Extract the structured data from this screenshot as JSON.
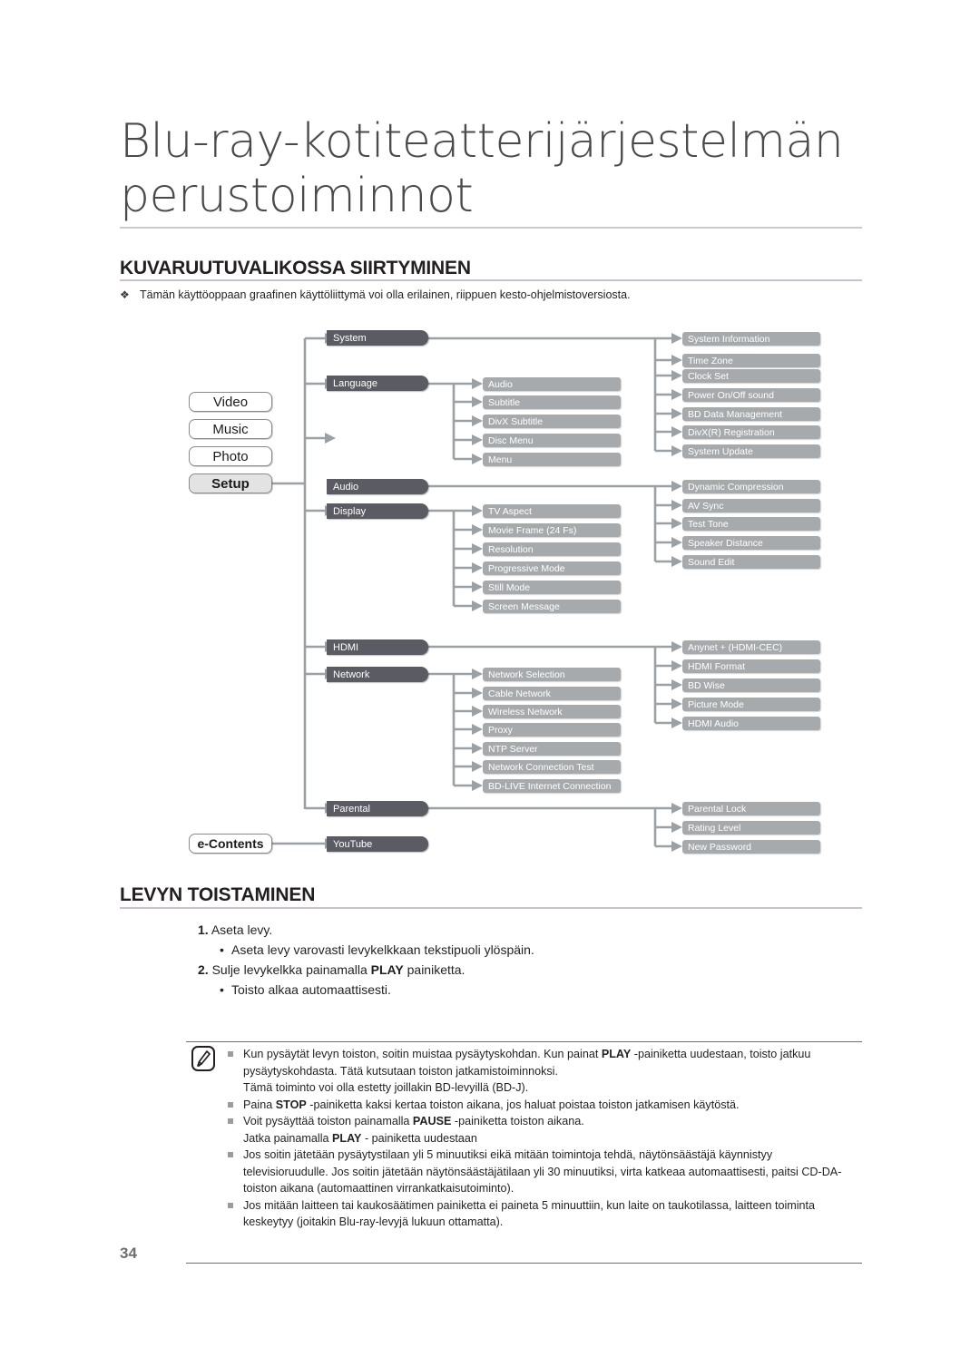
{
  "header": {
    "chapter_title": "Blu-ray-kotiteatterijärjestelmän\nperustoiminnot"
  },
  "section1": {
    "heading": "KUVARUUTUVALIKOSSA SIIRTYMINEN",
    "bullet_glyph": "❖",
    "note": "Tämän käyttöoppaan graafinen käyttöliittymä voi olla erilainen, riippuen kesto-ohjelmistoversiosta."
  },
  "diagram": {
    "level1": [
      {
        "label": "Video",
        "selected": false
      },
      {
        "label": "Music",
        "selected": false
      },
      {
        "label": "Photo",
        "selected": false
      },
      {
        "label": "Setup",
        "selected": true
      }
    ],
    "econtents": {
      "label": "e-Contents"
    },
    "level2": [
      {
        "label": "System"
      },
      {
        "label": "Language"
      },
      {
        "label": "Audio"
      },
      {
        "label": "Display"
      },
      {
        "label": "HDMI"
      },
      {
        "label": "Network"
      },
      {
        "label": "Parental"
      },
      {
        "label": "YouTube"
      }
    ],
    "system_children": [
      "System Information",
      "Time Zone",
      "Clock Set",
      "Power On/Off sound",
      "BD Data Management",
      "DivX(R) Registration",
      "System Update"
    ],
    "language_children": [
      "Audio",
      "Subtitle",
      "DivX Subtitle",
      "Disc Menu",
      "Menu"
    ],
    "audio_children": [
      "Dynamic Compression",
      "AV Sync",
      "Test Tone",
      "Speaker Distance",
      "Sound Edit"
    ],
    "display_children": [
      "TV Aspect",
      "Movie Frame (24 Fs)",
      "Resolution",
      "Progressive Mode",
      "Still Mode",
      "Screen Message"
    ],
    "hdmi_children": [
      "Anynet + (HDMI-CEC)",
      "HDMI Format",
      "BD Wise",
      "Picture Mode",
      "HDMI Audio"
    ],
    "network_children": [
      "Network Selection",
      "Cable Network",
      "Wireless Network",
      "Proxy",
      "NTP Server",
      "Network Connection Test",
      "BD-LIVE Internet Connection"
    ],
    "parental_children": [
      "Parental Lock",
      "Rating Level",
      "New Password"
    ],
    "colors": {
      "level1_border": "#8b8b8b",
      "level1_selected_fill": "#e3e3e3",
      "level2_fill": "#5b5b64",
      "level3_fill": "#a7aaac",
      "connector": "#9aa0a4"
    }
  },
  "section2": {
    "heading": "LEVYN TOISTAMINEN",
    "steps": [
      {
        "num": "1.",
        "text": "Aseta levy."
      },
      {
        "bullet": "•",
        "text": "Aseta levy varovasti levykelkkaan tekstipuoli ylöspäin."
      },
      {
        "num": "2.",
        "text_before": "Sulje levykelkka painamalla ",
        "bold": "PLAY",
        "text_after": " painiketta."
      },
      {
        "bullet": "•",
        "text": "Toisto alkaa automaattisesti."
      }
    ]
  },
  "notes": {
    "icon_name": "note-pencil-icon",
    "items": [
      {
        "parts": [
          {
            "t": "Kun pysäytät levyn toiston, soitin muistaa pysäytyskohdan. Kun painat "
          },
          {
            "t": "PLAY",
            "b": true
          },
          {
            "t": " -painiketta uudestaan, toisto jatkuu pysäytyskohdasta. Tätä kutsutaan toiston jatkamistoiminnoksi."
          }
        ],
        "sub": "Tämä toiminto voi olla estetty joillakin BD-levyillä (BD-J)."
      },
      {
        "parts": [
          {
            "t": "Paina "
          },
          {
            "t": "STOP",
            "b": true
          },
          {
            "t": " -painiketta kaksi kertaa toiston aikana, jos haluat poistaa toiston jatkamisen käytöstä."
          }
        ]
      },
      {
        "parts": [
          {
            "t": "Voit pysäyttää toiston painamalla "
          },
          {
            "t": "PAUSE",
            "b": true
          },
          {
            "t": " -painiketta toiston aikana."
          }
        ],
        "sub_parts": [
          {
            "t": "Jatka painamalla "
          },
          {
            "t": "PLAY",
            "b": true
          },
          {
            "t": " - painiketta uudestaan"
          }
        ]
      },
      {
        "parts": [
          {
            "t": "Jos soitin jätetään pysäytystilaan yli 5 minuutiksi eikä mitään toimintoja tehdä, näytönsäästäjä käynnistyy televisioruudulle. Jos soitin jätetään näytönsäästäjätilaan yli 30 minuutiksi, virta katkeaa automaattisesti, paitsi CD-DA-toiston aikana (automaattinen virrankatkaisutoiminto)."
          }
        ]
      },
      {
        "parts": [
          {
            "t": "Jos mitään laitteen tai kaukosäätimen painiketta ei paineta 5 minuuttiin, kun laite on taukotilassa, laitteen toiminta keskeytyy (joitakin Blu-ray-levyjä lukuun ottamatta)."
          }
        ]
      }
    ]
  },
  "footer": {
    "page_number": "34"
  }
}
